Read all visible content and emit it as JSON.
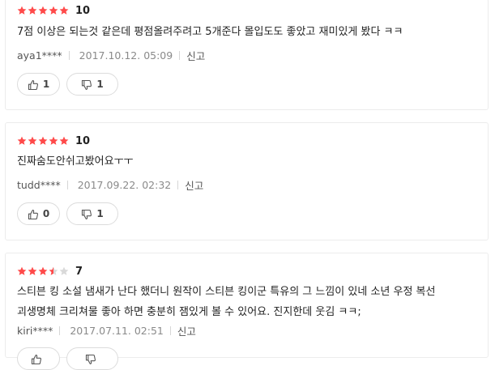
{
  "colors": {
    "star_filled": "#ff4a4a",
    "star_empty": "#d9d9d9",
    "border": "#ececec"
  },
  "icons": {
    "star": "star-icon",
    "thumbs_up": "thumbs-up-icon",
    "thumbs_down": "thumbs-down-icon"
  },
  "reviews": [
    {
      "stars": 5,
      "score": "10",
      "text": [
        "7점 이상은 되는것 같은데 평점올려주려고 5개준다 몰입도도 좋았고 재미있게 봤다 ㅋㅋ"
      ],
      "author": "aya1****",
      "date": "2017.10.12. 05:09",
      "report_label": "신고",
      "likes": "1",
      "dislikes": "1"
    },
    {
      "stars": 5,
      "score": "10",
      "text": [
        "진짜숨도안쉬고봤어요ㅜㅜ"
      ],
      "author": "tudd****",
      "date": "2017.09.22. 02:32",
      "report_label": "신고",
      "likes": "0",
      "dislikes": "1"
    },
    {
      "stars": 3.5,
      "score": "7",
      "text": [
        "스티븐 킹 소설 냄새가 난다 했더니 원작이 스티븐 킹이군 특유의 그 느낌이 있네 소년 우정 복선",
        "괴생명체 크리쳐물 좋아 하면 충분히 잼있게 볼 수 있어요. 진지한데 웃김 ㅋㅋ;"
      ],
      "author": "kiri****",
      "date": "2017.07.11. 02:51",
      "report_label": "신고",
      "likes": "",
      "dislikes": ""
    }
  ]
}
